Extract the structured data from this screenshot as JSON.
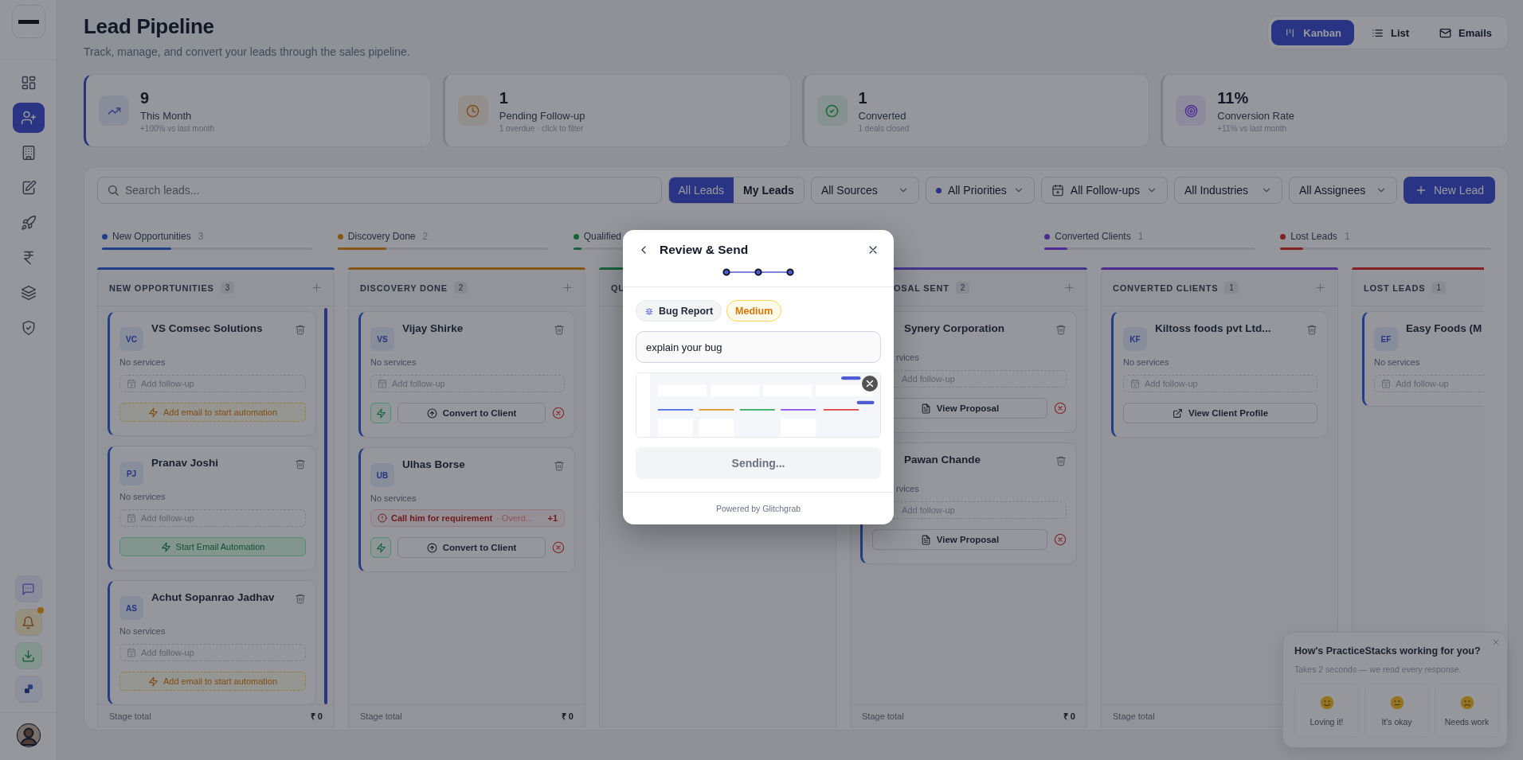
{
  "sidebar": {
    "items": [
      {
        "selected": false
      },
      {
        "selected": true
      },
      {
        "selected": false
      },
      {
        "selected": false
      },
      {
        "selected": false
      },
      {
        "selected": false
      },
      {
        "selected": false
      },
      {
        "selected": false
      }
    ],
    "notifications": {
      "unread": true
    }
  },
  "header": {
    "title": "Lead Pipeline",
    "subtitle": "Track, manage, and convert your leads through the sales pipeline.",
    "views": [
      {
        "label": "Kanban",
        "selected": true
      },
      {
        "label": "List",
        "selected": false
      },
      {
        "label": "Emails",
        "selected": false
      }
    ]
  },
  "stats": [
    {
      "value": "9",
      "label": "This Month",
      "note": "+100% vs last month",
      "selected": true
    },
    {
      "value": "1",
      "label": "Pending Follow-up",
      "note": "1 overdue · click to filter",
      "selected": false
    },
    {
      "value": "1",
      "label": "Converted",
      "note": "1 deals closed",
      "selected": false
    },
    {
      "value": "11%",
      "label": "Conversion Rate",
      "note": "+11% vs last month",
      "selected": false
    }
  ],
  "filters": {
    "search": {
      "placeholder": "Search leads..."
    },
    "scope": [
      {
        "label": "All Leads",
        "selected": true
      },
      {
        "label": "My Leads",
        "selected": false
      }
    ],
    "dropdowns": [
      {
        "label": "All Sources",
        "kind": "plain"
      },
      {
        "label": "All Priorities",
        "kind": "dot"
      },
      {
        "label": "All Follow-ups",
        "kind": "calendar"
      },
      {
        "label": "All Industries",
        "kind": "plain"
      },
      {
        "label": "All Assignees",
        "kind": "plain"
      }
    ],
    "new_button": "New Lead"
  },
  "stages": [
    {
      "label": "New Opportunities",
      "count": "3",
      "color": "#233d8b",
      "level": 0.33
    },
    {
      "label": "Discovery Done",
      "count": "2",
      "color": "#845716",
      "level": 0.23
    },
    {
      "label": "Qualified",
      "color": "#156439",
      "level": 0.04
    },
    {
      "label": "Converted Clients",
      "count": "1",
      "color": "#4d2b93",
      "level": 0.11
    },
    {
      "label": "Lost Leads",
      "count": "1",
      "color": "#822025",
      "level": 0.11
    }
  ],
  "columns": [
    {
      "title": "NEW OPPORTUNITIES",
      "count": "3",
      "color": "#233d8b",
      "add": true,
      "clipped": false,
      "cards": [
        {
          "initials": "VC",
          "name": "VS Comsec Solutions",
          "services": "No services",
          "followup": "Add follow-up",
          "action": {
            "kind": "hint",
            "label": "Add email to start automation"
          }
        },
        {
          "initials": "PJ",
          "name": "Pranav Joshi",
          "services": "No services",
          "followup": "Add follow-up",
          "action": {
            "kind": "start",
            "label": "Start Email Automation"
          }
        },
        {
          "initials": "AS",
          "name": "Achut Sopanrao Jadhav",
          "services": "No services",
          "followup": "Add follow-up",
          "action": {
            "kind": "hint",
            "label": "Add email to start automation"
          }
        }
      ],
      "footer": {
        "label": "Stage total",
        "amount": "₹ 0"
      }
    },
    {
      "title": "DISCOVERY DONE",
      "count": "2",
      "color": "#845716",
      "add": true,
      "clipped": false,
      "cards": [
        {
          "initials": "VS",
          "name": "Vijay Shirke",
          "services": "No services",
          "followup": "Add follow-up",
          "action": {
            "kind": "convert",
            "label": "Convert to Client"
          }
        },
        {
          "initials": "UB",
          "name": "Ulhas Borse",
          "services": "No services",
          "alert": {
            "text": "Call him for requirement",
            "note": "· Overd...",
            "extra": "+1"
          },
          "action": {
            "kind": "convert",
            "label": "Convert to Client"
          }
        }
      ],
      "footer": {
        "label": "Stage total",
        "amount": "₹ 0"
      }
    },
    {
      "title": "QU",
      "color": "#156439",
      "clipped": false
    },
    {
      "title": "OSAL SENT",
      "count": "2",
      "color": "#453490",
      "add": true,
      "clipped": true,
      "cards": [
        {
          "name": "Synery Corporation",
          "services": "rvices",
          "followup": "Add follow-up",
          "action": {
            "kind": "proposal",
            "label": "View Proposal"
          }
        },
        {
          "name": "Pawan Chande",
          "services": "rvices",
          "followup": "Add follow-up",
          "action": {
            "kind": "proposal",
            "label": "View Proposal"
          }
        }
      ],
      "footer": {
        "label": "Stage total",
        "amount": "₹ 0"
      }
    },
    {
      "title": "CONVERTED CLIENTS",
      "count": "1",
      "color": "#4d2b93",
      "add": true,
      "clipped": false,
      "cards": [
        {
          "initials": "KF",
          "name": "Kiltoss foods pvt Ltd...",
          "services": "No services",
          "followup": "Add follow-up",
          "action": {
            "kind": "profile",
            "label": "View Client Profile"
          }
        }
      ],
      "footer": {
        "label": "Stage total"
      }
    },
    {
      "title": "LOST LEADS",
      "count": "1",
      "color": "#822025",
      "clipped": false,
      "cards": [
        {
          "initials": "EF",
          "name": "Easy Foods (M",
          "services": "No services",
          "followup": "Add follow-up"
        }
      ]
    }
  ],
  "survey": {
    "title": "How's PracticeStacks working for you?",
    "subtitle": "Takes 2 seconds — we read every response.",
    "options": [
      {
        "label": "Loving it!",
        "kind": "happy"
      },
      {
        "label": "It's okay",
        "kind": "neutral"
      },
      {
        "label": "Needs work",
        "kind": "sad"
      }
    ]
  },
  "modal": {
    "title": "Review & Send",
    "chips": [
      {
        "label": "Bug Report",
        "kind": "type"
      },
      {
        "label": "Medium",
        "kind": "priority"
      }
    ],
    "input": {
      "value": "explain your bug"
    },
    "button": {
      "label": "Sending...",
      "disabled": true
    },
    "footer": "Powered by Glitchgrab"
  }
}
